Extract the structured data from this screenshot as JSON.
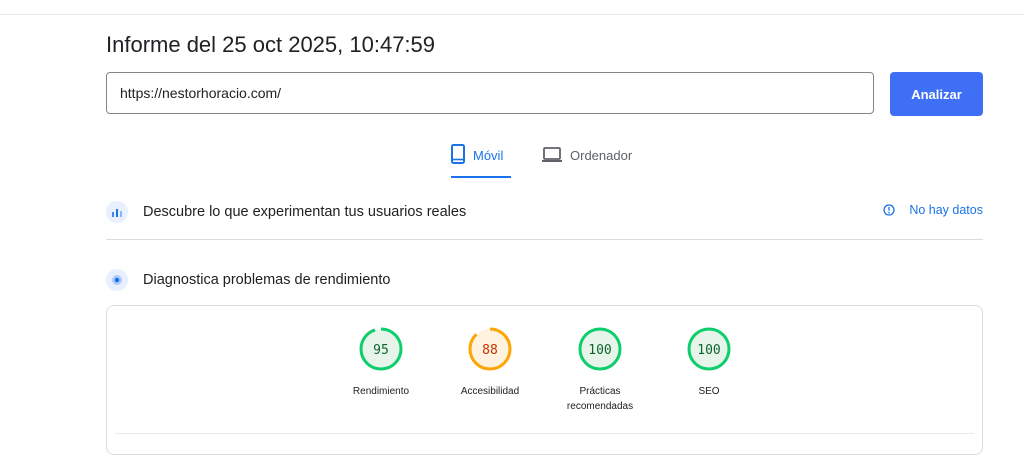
{
  "report": {
    "title": "Informe del 25 oct 2025, 10:47:59"
  },
  "search": {
    "url_value": "https://nestorhoracio.com/",
    "analyze_label": "Analizar"
  },
  "tabs": [
    {
      "label": "Móvil",
      "icon": "smartphone-icon",
      "selected": true
    },
    {
      "label": "Ordenador",
      "icon": "laptop-icon",
      "selected": false
    }
  ],
  "crux": {
    "title": "Descubre lo que experimentan tus usuarios reales",
    "status": "No hay datos",
    "status_icon": "info-icon"
  },
  "lab": {
    "title": "Diagnostica problemas de rendimiento",
    "scores": [
      {
        "label": "Rendimiento",
        "value": 95,
        "status": "good"
      },
      {
        "label": "Accesibilidad",
        "value": 88,
        "status": "average"
      },
      {
        "label": "Prácticas recomendadas",
        "value": 100,
        "status": "good"
      },
      {
        "label": "SEO",
        "value": 100,
        "status": "good"
      }
    ]
  },
  "colors": {
    "accent": "#1a73e8",
    "button": "#3e6ff5",
    "good_ring": "#0cce6b",
    "good_fill": "#e6f4ea",
    "good_text": "#0d652d",
    "average_ring": "#ffa400",
    "average_fill": "#fff3e0",
    "average_text": "#c33300"
  }
}
